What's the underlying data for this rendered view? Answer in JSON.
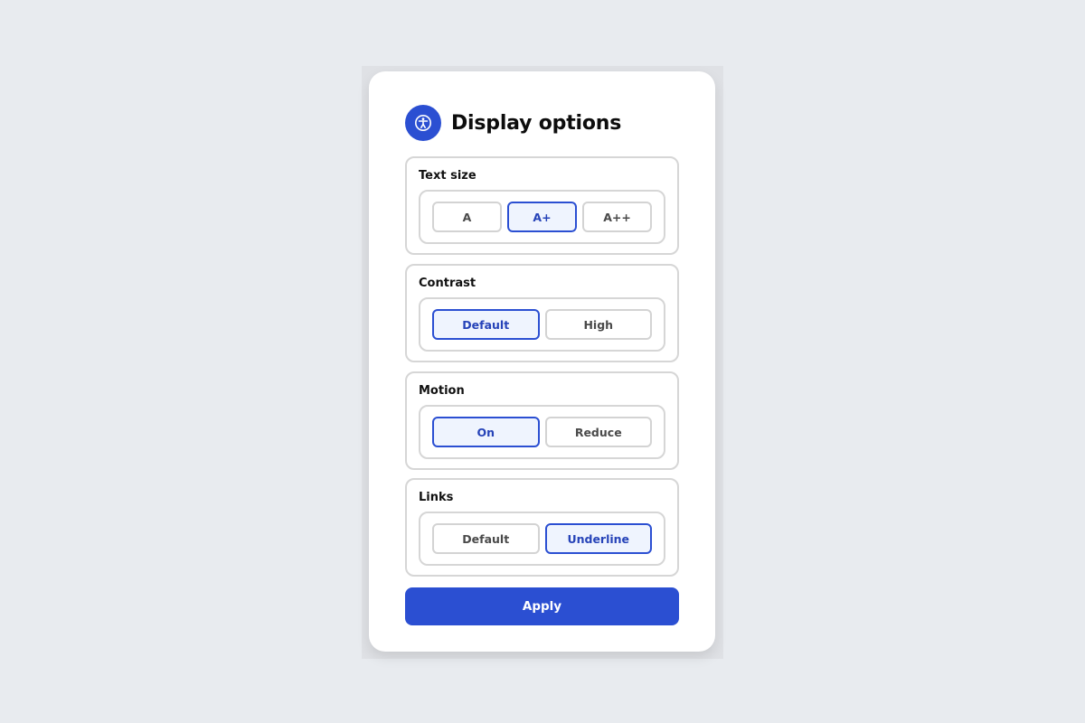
{
  "panel": {
    "title": "Display options",
    "icon": "accessibility-icon",
    "accent_color": "#2b4fd2"
  },
  "groups": [
    {
      "label": "Text size",
      "options": [
        "A",
        "A+",
        "A++"
      ],
      "selected": "A+"
    },
    {
      "label": "Contrast",
      "options": [
        "Default",
        "High"
      ],
      "selected": "Default"
    },
    {
      "label": "Motion",
      "options": [
        "On",
        "Reduce"
      ],
      "selected": "On"
    },
    {
      "label": "Links",
      "options": [
        "Default",
        "Underline"
      ],
      "selected": "Underline"
    }
  ],
  "apply_label": "Apply"
}
